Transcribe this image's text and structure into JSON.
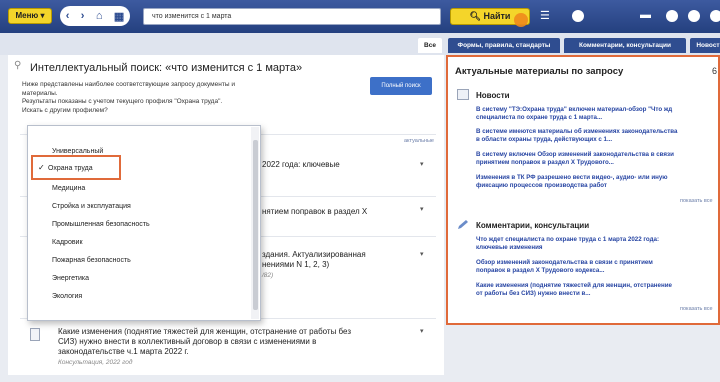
{
  "toolbar": {
    "menu_label": "Меню",
    "back_icon": "arrow-left-icon",
    "forward_icon": "arrow-right-icon",
    "home_icon": "home-icon",
    "grid_icon": "grid-icon",
    "search_value": "что изменится с 1 марта",
    "find_label": "Найти"
  },
  "tabs": {
    "all": "Все",
    "forms": "Формы, правила, стандарты",
    "comments": "Комментарии, консультации",
    "news": "Новости"
  },
  "left": {
    "title": "Интеллектуальный поиск: «что изменится с 1 марта»",
    "desc1": "Ниже представлены наиболее соответствующие запросу документы и",
    "desc2": "материалы.",
    "desc3": "Результаты показаны с учетом текущего профиля \"Охрана труда\".",
    "desc4": "Искать с другим профилем?",
    "full_search": "Полный поиск",
    "actual": "актуальные",
    "results": [
      {
        "title": "2022 года: ключевые"
      },
      {
        "title": "нятием поправок в раздел X"
      },
      {
        "title1": "здания. Актуализированная",
        "title2": "нениями N 1, 2, 3)",
        "sub": "/82)"
      },
      {
        "title1": "Какие изменения (поднятие тяжестей для женщин, отстранение от работы без",
        "title2": "СИЗ) нужно внести в коллективный договор в связи с изменениями в",
        "title3": "законодательстве ч.1 марта 2022 г.",
        "sub": "Консультация, 2022 год"
      }
    ]
  },
  "profiles": {
    "items": [
      "Универсальный",
      "Охрана труда",
      "Медицина",
      "Стройка и эксплуатация",
      "Промышленная безопасность",
      "Кадровик",
      "Пожарная безопасность",
      "Энергетика",
      "Экология"
    ],
    "selected": "Охрана труда"
  },
  "right": {
    "title": "Актуальные материалы по запросу",
    "count": "6",
    "news_header": "Новости",
    "news": [
      {
        "l1": "В систему \"ТЭ:Охрана труда\" включен материал-обзор \"Что жд",
        "l2": "специалиста по охране труда с 1 марта..."
      },
      {
        "l1": "В системе имеются материалы об изменениях законодательства",
        "l2": "в области охраны труда, действующих с 1..."
      },
      {
        "l1": "В систему включен Обзор изменений законодательства в связи",
        "l2": "принятием поправок в раздел X Трудового..."
      },
      {
        "l1": "Изменения в ТК РФ разрешено вести видео-, аудио- или иную",
        "l2": "фиксацию процессов производства работ"
      }
    ],
    "more1": "показать все",
    "comments_header": "Комментарии, консультации",
    "comments": [
      {
        "l1": "Что ждет специалиста по охране труда с 1 марта 2022 года:",
        "l2": "ключевые изменения"
      },
      {
        "l1": "Обзор изменений законодательства в связи с принятием",
        "l2": "поправок в раздел X Трудового кодекса..."
      },
      {
        "l1": "Какие изменения (поднятие тяжестей для женщин, отстранение",
        "l2": "от работы без СИЗ) нужно внести в..."
      }
    ],
    "more2": "показать все"
  }
}
